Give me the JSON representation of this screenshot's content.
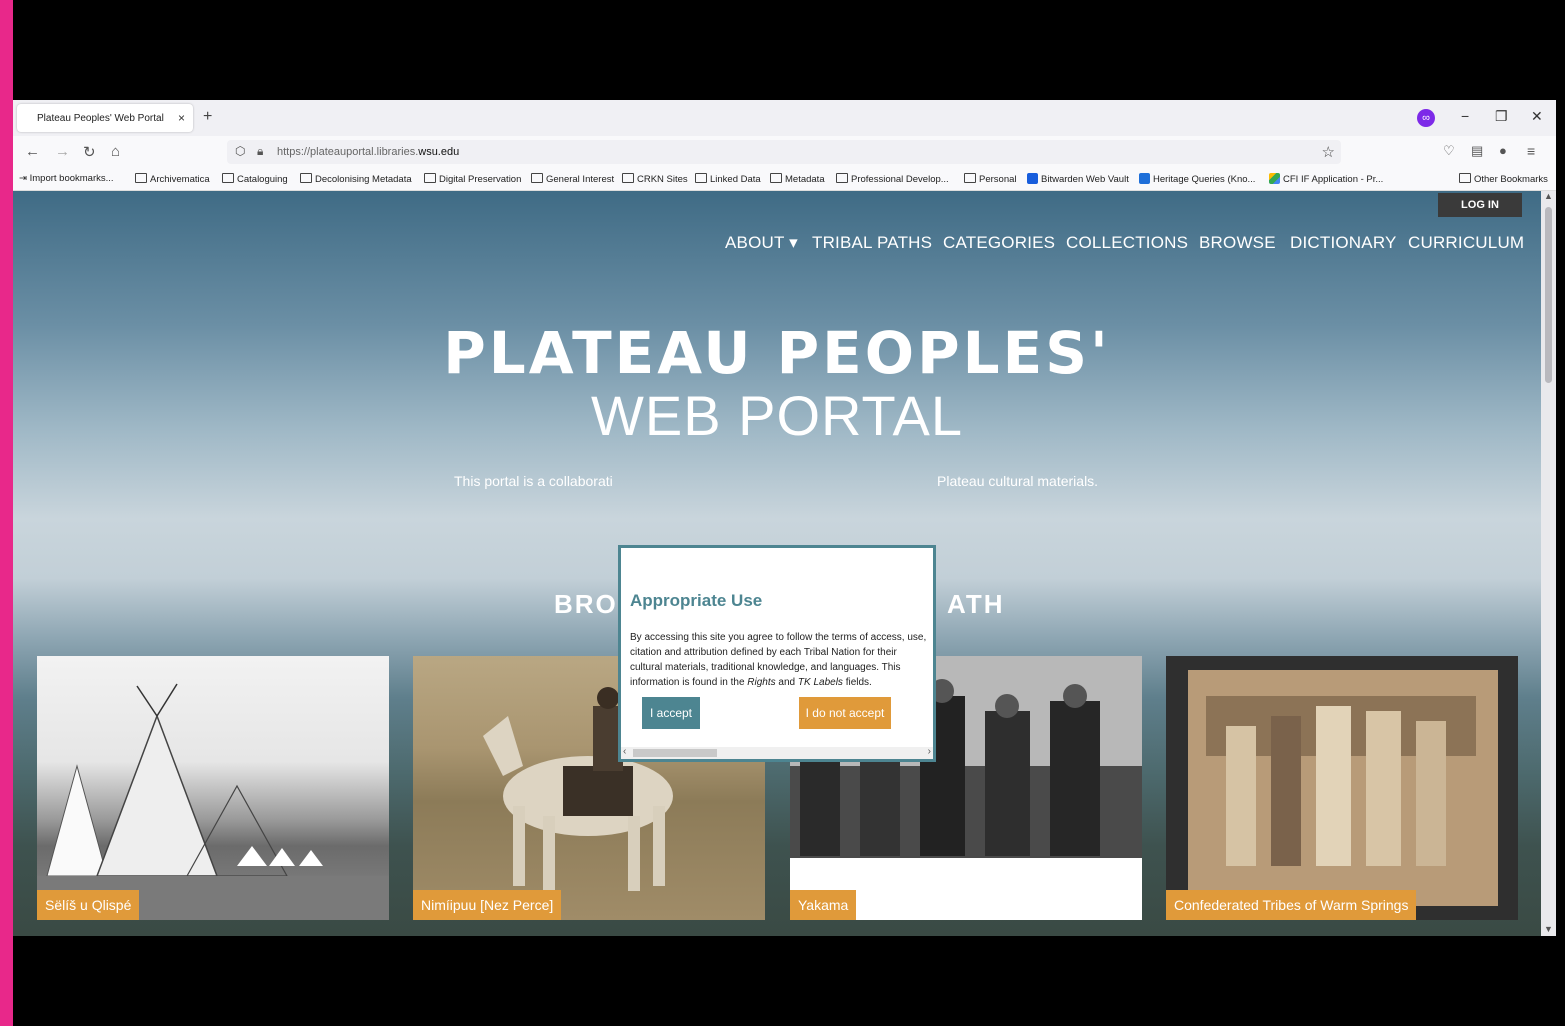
{
  "browser": {
    "tab_title": "Plateau Peoples' Web Portal | Pl",
    "tab_close": "×",
    "new_tab": "+",
    "url_prefix": "https://plateauportal.libraries.",
    "url_domain": "wsu.edu",
    "window_controls": [
      "−",
      "❐",
      "✕"
    ],
    "bookmarks": [
      "Import bookmarks...",
      "Archivematica",
      "Cataloguing",
      "Decolonising Metadata",
      "Digital Preservation",
      "General Interest",
      "CRKN Sites",
      "Linked Data",
      "Metadata",
      "Professional Develop...",
      "Personal",
      "Bitwarden Web Vault",
      "Heritage Queries (Kno...",
      "CFI IF Application - Pr...",
      "Other Bookmarks"
    ]
  },
  "site": {
    "login": "LOG IN",
    "nav": [
      "ABOUT ▾",
      "TRIBAL PATHS",
      "CATEGORIES",
      "COLLECTIONS",
      "BROWSE",
      "DICTIONARY",
      "CURRICULUM"
    ],
    "title_line1": "PLATEAU PEOPLES'",
    "title_line2": "WEB PORTAL",
    "intro_left": "This portal is a collaborati",
    "intro_right": "Plateau cultural materials.",
    "browse_left": "BRO",
    "browse_right": "ATH",
    "cards": [
      {
        "label": "Sëlíš u Qlispé"
      },
      {
        "label": "Nimíipuu [Nez Perce]"
      },
      {
        "label": "Yakama"
      },
      {
        "label": "Confederated Tribes of Warm Springs"
      }
    ]
  },
  "modal": {
    "title": "Appropriate Use",
    "body_1": "By accessing this site you agree to follow the terms of access, use, citation and attribution defined by each Tribal Nation for their cultural materials, traditional knowledge, and languages. This information is found in the ",
    "body_rights": "Rights",
    "body_and": " and ",
    "body_tk": "TK Labels",
    "body_end": " fields.",
    "accept": "I accept",
    "decline": "I do not accept"
  },
  "colors": {
    "accent_teal": "#4d8591",
    "accent_orange": "#e09a3a",
    "side_bar_pink": "#e8288a"
  }
}
